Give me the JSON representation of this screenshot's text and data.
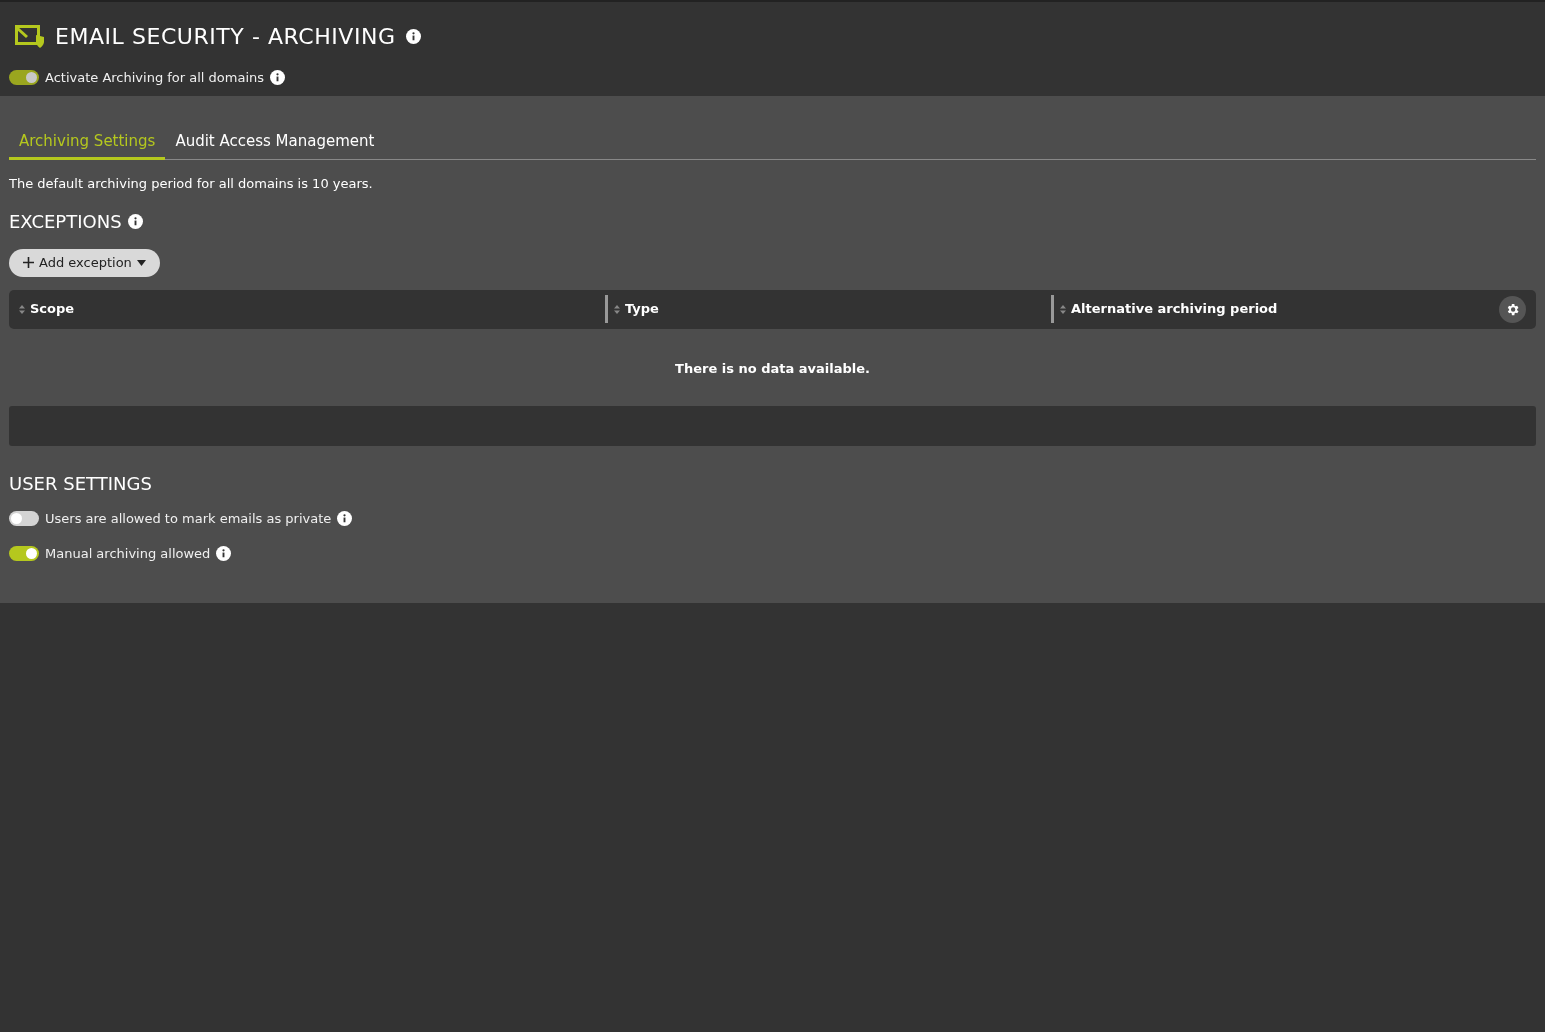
{
  "header": {
    "title": "EMAIL SECURITY - ARCHIVING",
    "toggle": {
      "label": "Activate Archiving for all domains",
      "on": true,
      "disabled": true
    }
  },
  "tabs": [
    {
      "label": "Archiving Settings",
      "selected": true
    },
    {
      "label": "Audit Access Management",
      "selected": false
    }
  ],
  "intro": "The default archiving period for all domains is 10 years.",
  "exceptions": {
    "heading": "EXCEPTIONS",
    "add_button": "Add exception",
    "table": {
      "columns": [
        "Scope",
        "Type",
        "Alternative archiving period"
      ],
      "empty_message": "There is no data available."
    }
  },
  "user_settings": {
    "heading": "USER SETTINGS",
    "toggles": [
      {
        "label": "Users are allowed to mark emails as private",
        "on": false,
        "disabled": false
      },
      {
        "label": "Manual archiving allowed",
        "on": true,
        "disabled": false
      }
    ]
  }
}
